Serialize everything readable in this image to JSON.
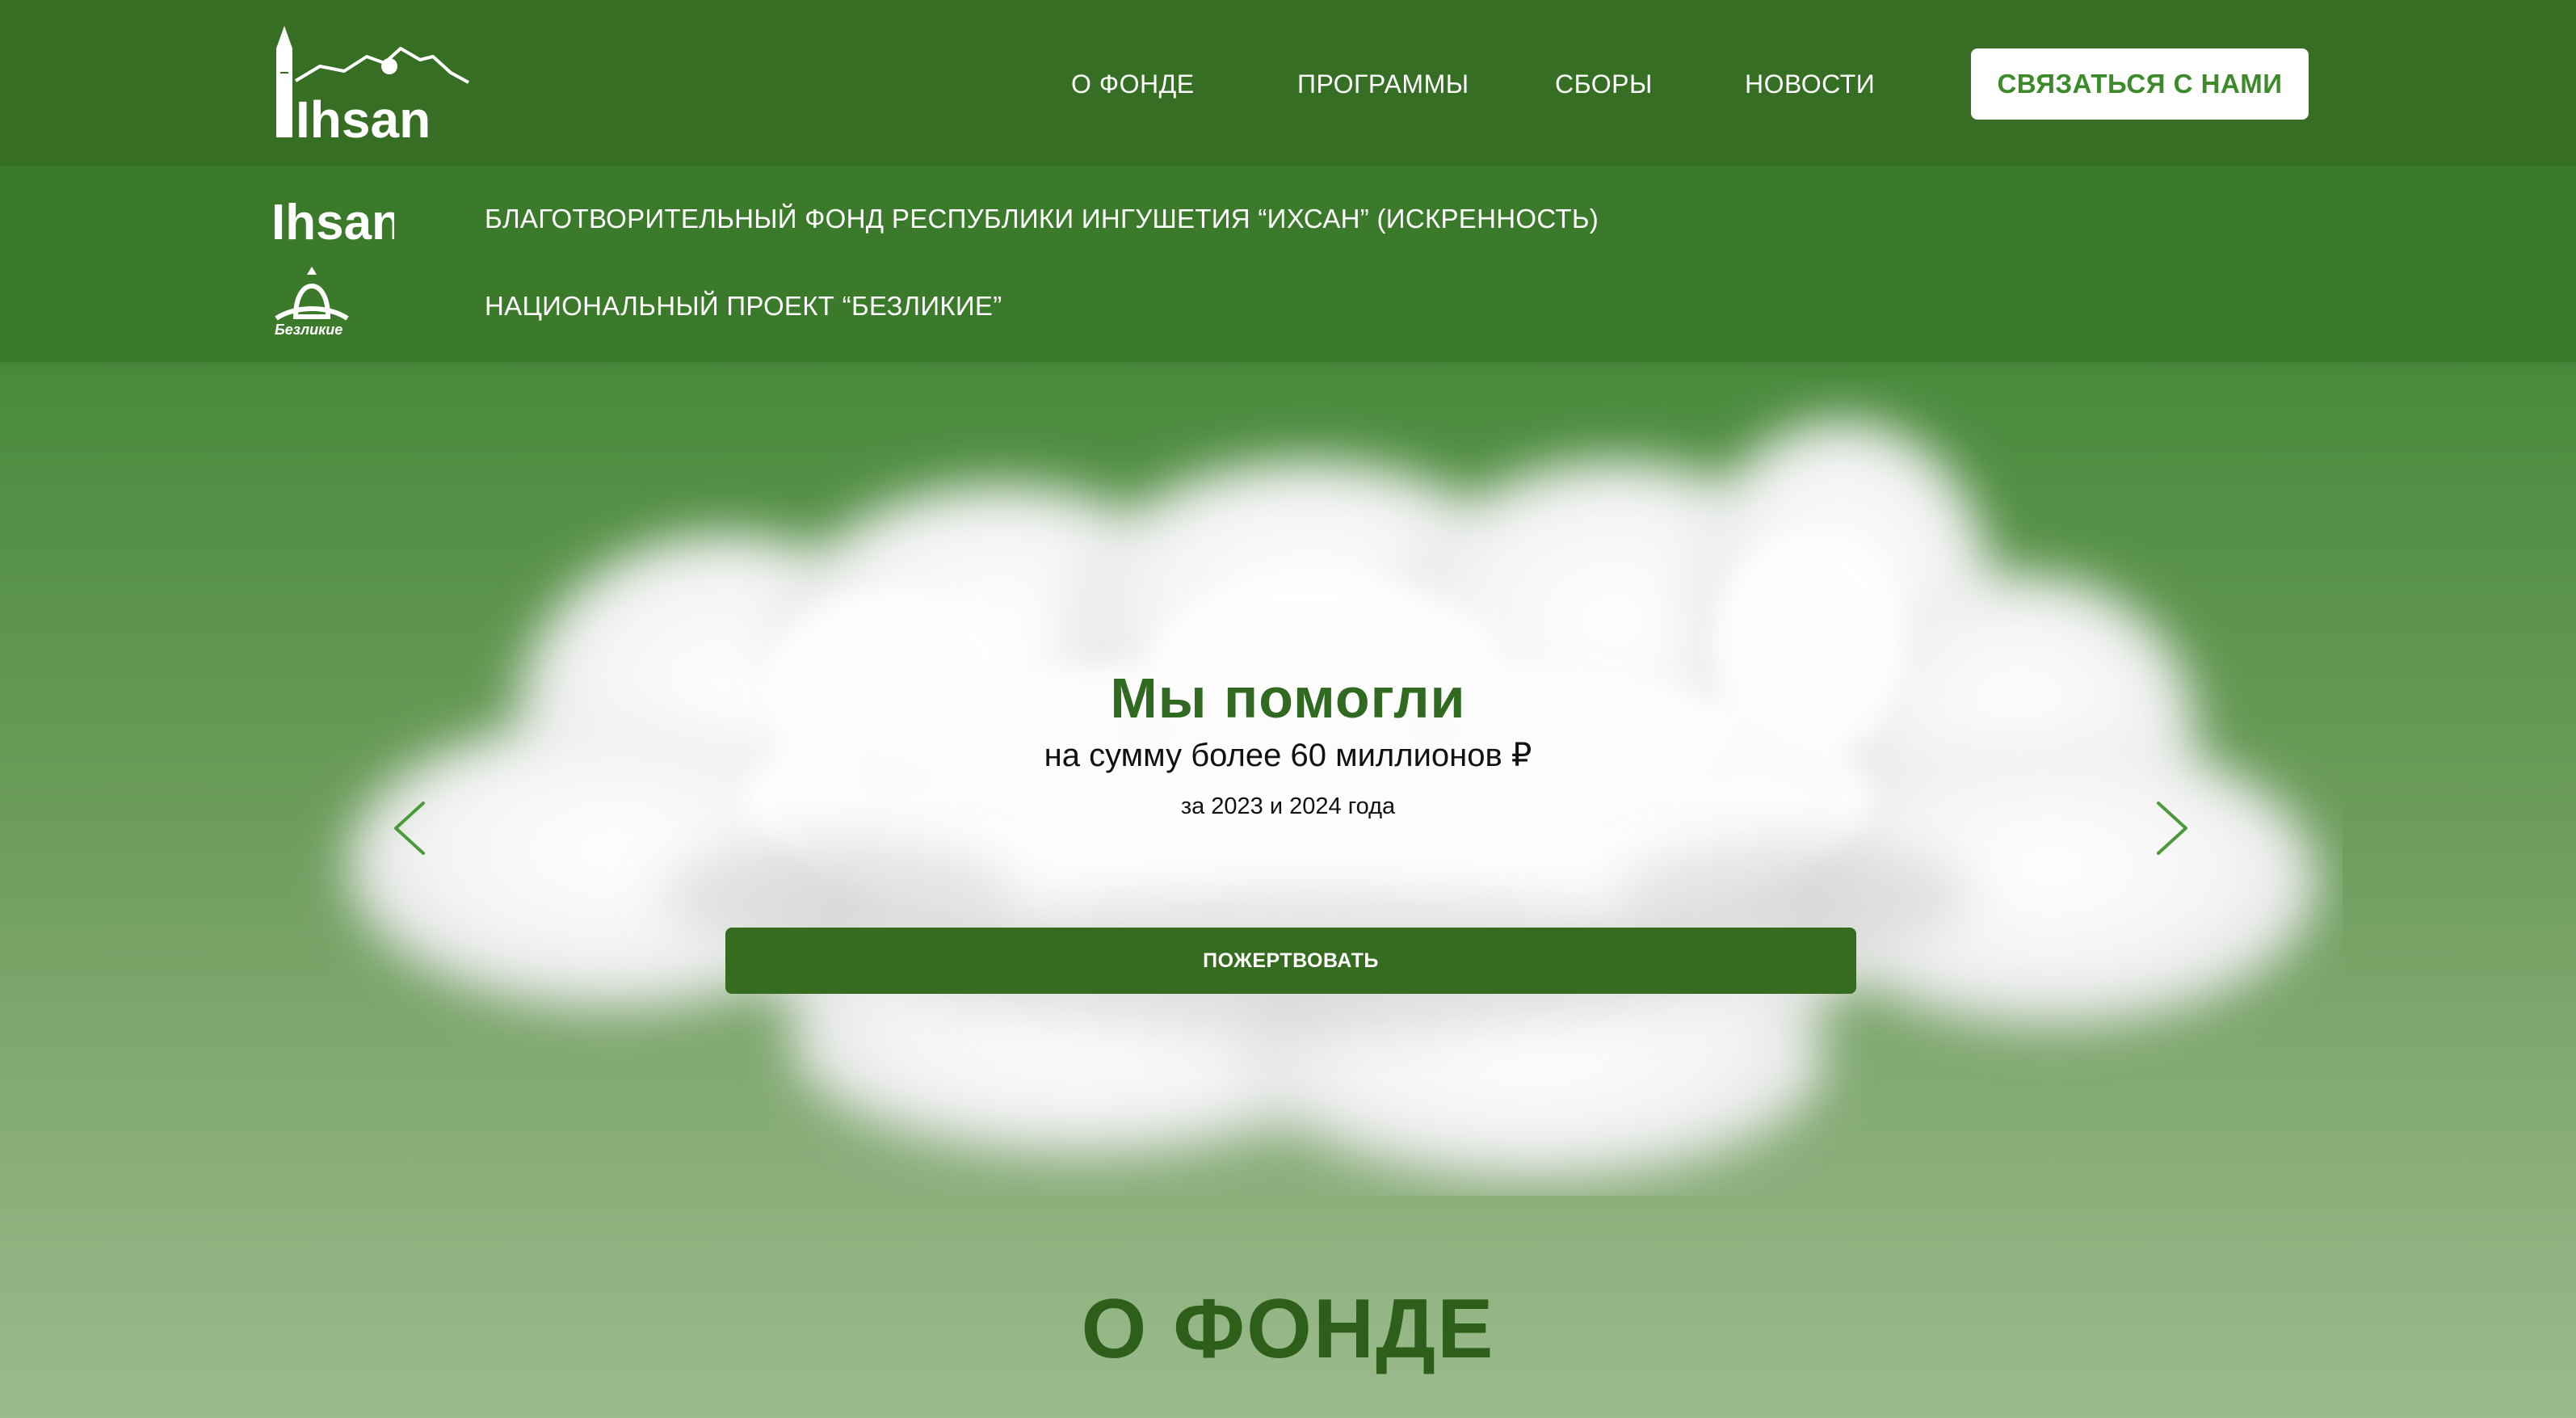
{
  "header": {
    "logo_text": "Ihsan",
    "nav": [
      {
        "label": "О ФОНДЕ"
      },
      {
        "label": "ПРОГРАММЫ"
      },
      {
        "label": "СБОРЫ"
      },
      {
        "label": "НОВОСТИ"
      }
    ],
    "contact_label": "СВЯЗАТЬСЯ С НАМИ"
  },
  "subbar": {
    "items": [
      {
        "logo_text": "Ihsan",
        "label": "БЛАГОТВОРИТЕЛЬНЫЙ ФОНД РЕСПУБЛИКИ ИНГУШЕТИЯ “ИХСАН” (ИСКРЕННОСТЬ)"
      },
      {
        "logo_text": "Безликие",
        "label": "НАЦИОНАЛЬНЫЙ ПРОЕКТ “БЕЗЛИКИЕ”"
      }
    ]
  },
  "hero": {
    "title": "Мы помогли",
    "subtitle": "на сумму более 60 миллионов ₽",
    "period": "за 2023 и 2024 года",
    "donate_label": "ПОЖЕРТВОВАТЬ"
  },
  "section": {
    "title": "О ФОНДЕ"
  },
  "colors": {
    "header_bg": "#366f23",
    "subbar_bg": "#3c7a2b",
    "accent_green": "#366c20",
    "title_green": "#2f6a20",
    "contact_text": "#3d8a2b"
  }
}
